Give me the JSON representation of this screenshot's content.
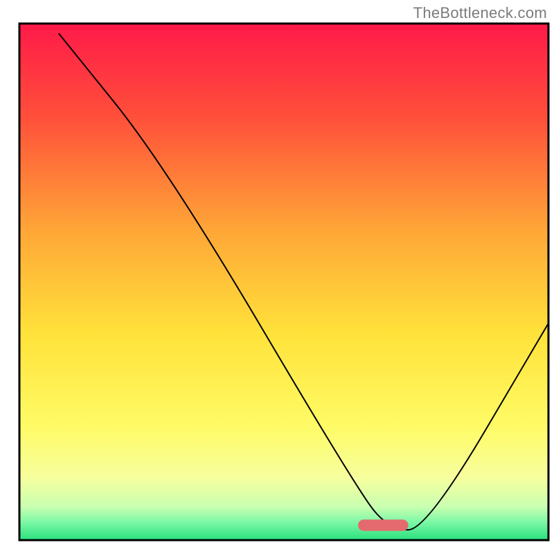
{
  "attribution": "TheBottleneck.com",
  "chart_data": {
    "type": "line",
    "title": "",
    "xlabel": "",
    "ylabel": "",
    "xlim": [
      0,
      100
    ],
    "ylim": [
      0,
      100
    ],
    "grid": false,
    "legend": false,
    "gradient_stops": [
      {
        "offset": 0.0,
        "color": "#ff1a49"
      },
      {
        "offset": 0.18,
        "color": "#ff4f3a"
      },
      {
        "offset": 0.4,
        "color": "#ffa637"
      },
      {
        "offset": 0.6,
        "color": "#ffe23a"
      },
      {
        "offset": 0.78,
        "color": "#fffb66"
      },
      {
        "offset": 0.88,
        "color": "#f6ff9e"
      },
      {
        "offset": 0.935,
        "color": "#c9ffb0"
      },
      {
        "offset": 0.965,
        "color": "#7cf8a6"
      },
      {
        "offset": 1.0,
        "color": "#28e07e"
      }
    ],
    "series": [
      {
        "name": "bottleneck-curve",
        "x": [
          7.5,
          28.0,
          64.0,
          70.0,
          77.0,
          100.0
        ],
        "values": [
          98.0,
          72.0,
          9.5,
          2.0,
          2.0,
          42.0
        ],
        "stroke": "#000000",
        "stroke_width": 2
      }
    ],
    "marker": {
      "name": "optimal-range",
      "shape": "rounded-rect",
      "color": "#e46a6f",
      "x_start": 64.0,
      "x_end": 73.5,
      "y": 1.8,
      "height": 2.2
    }
  }
}
